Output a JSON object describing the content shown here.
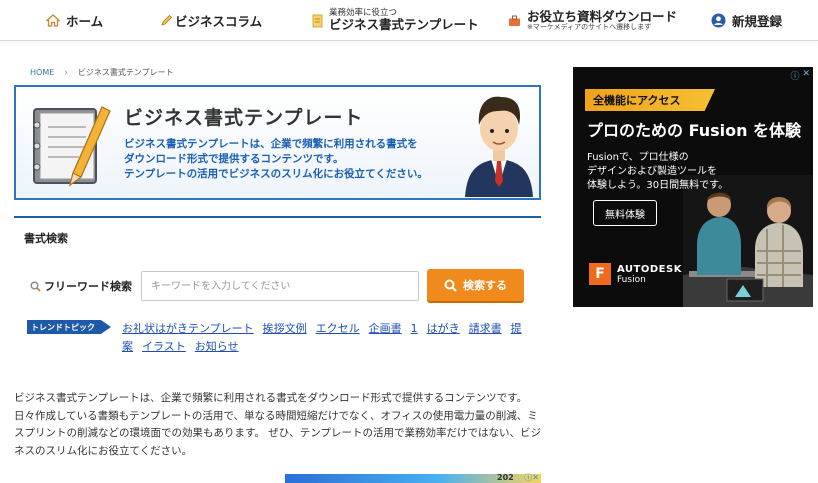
{
  "nav": {
    "home": "ホーム",
    "column": "ビジネスコラム",
    "template_small": "業務効率に役立つ",
    "template_big": "ビジネス書式テンプレート",
    "download_big": "お役立ち資料ダウンロード",
    "download_sub": "※マーケメディアのサイトへ遷移します",
    "register": "新規登録"
  },
  "breadcrumb": {
    "home": "HOME",
    "current": "ビジネス書式テンプレート"
  },
  "banner": {
    "title": "ビジネス書式テンプレート",
    "desc_line1": "ビジネス書式テンプレートは、企業で頻繁に利用される書式を",
    "desc_line2": "ダウンロード形式で提供するコンテンツです。",
    "desc_line3": "テンプレートの活用でビジネスのスリム化にお役立てください。"
  },
  "search": {
    "section_title": "書式検索",
    "label": "フリーワード検索",
    "placeholder": "キーワードを入力してください",
    "button": "検索する"
  },
  "trend": {
    "badge": "トレンドトピック",
    "links": [
      "お礼状はがきテンプレート",
      "挨拶文例",
      "エクセル",
      "企画書",
      "1",
      "はがき",
      "請求書",
      "提案",
      "イラスト",
      "お知らせ"
    ]
  },
  "body_text": "ビジネス書式テンプレートは、企業で頻繁に利用される書式をダウンロード形式で提供するコンテンツです。 日々作成している書類もテンプレートの活用で、単なる時間短縮だけでなく、オフィスの使用電力量の削減、ミスプリントの削減などの環境面での効果もあります。 ぜひ、テンプレートの活用で業務効率だけではない、ビジネスのスリム化にお役立てください。",
  "bottom_ad": {
    "label": "202"
  },
  "ad": {
    "ribbon": "全機能にアクセス",
    "headline": "プロのための Fusion を体験",
    "copy_line1": "Fusionで、プロ仕様の",
    "copy_line2": "デザインおよび製造ツールを",
    "copy_line3": "体験しよう。30日間無料です。",
    "cta": "無料体験",
    "brand_top": "AUTODESK",
    "brand_bottom": "Fusion",
    "logo_letter": "F"
  },
  "colors": {
    "accent_blue": "#1f5fa8",
    "search_orange": "#f08a1c",
    "link_blue": "#1f4fb4"
  }
}
